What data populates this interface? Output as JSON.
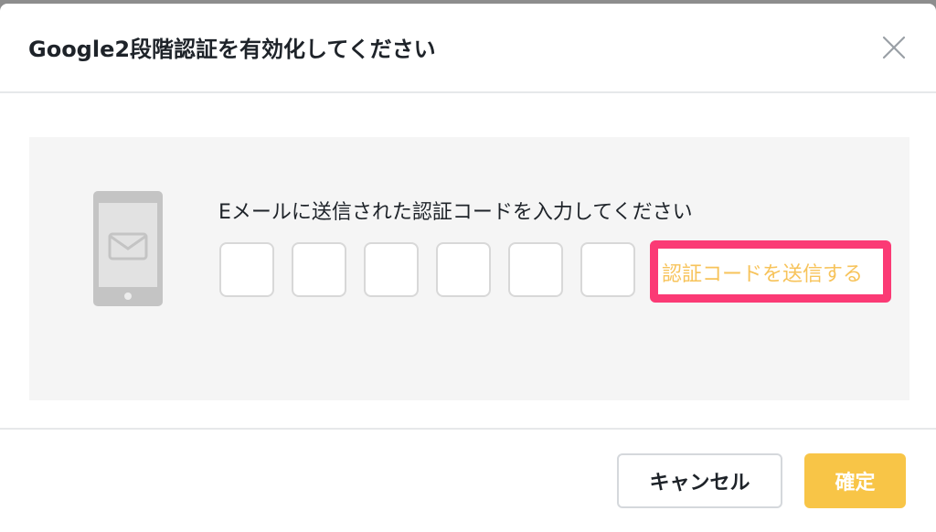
{
  "dialog": {
    "title": "Google2段階認証を有効化してください"
  },
  "body": {
    "instruction": "Eメールに送信された認証コードを入力してください",
    "code_inputs": [
      "",
      "",
      "",
      "",
      "",
      ""
    ],
    "send_code_label": "認証コードを送信する"
  },
  "footer": {
    "cancel_label": "キャンセル",
    "confirm_label": "確定"
  },
  "icons": {
    "close": "close-icon",
    "phone": "phone-mail-icon"
  },
  "colors": {
    "accent": "#f8c547",
    "highlight": "#fb3a75",
    "link": "#f7c35a",
    "panel_bg": "#f5f5f5"
  }
}
